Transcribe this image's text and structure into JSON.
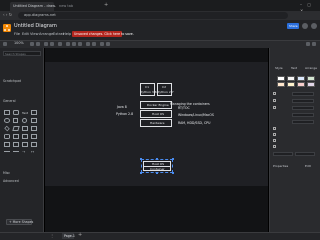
{
  "browser": {
    "tabs": [
      {
        "label": "Untitled Diagram - draw.io"
      },
      {
        "label": "new tab"
      }
    ],
    "url": "app.diagrams.net"
  },
  "app": {
    "title": "Untitled Diagram",
    "menus": [
      "File",
      "Edit",
      "View",
      "Arrange",
      "Extras",
      "Help"
    ],
    "notice": "Unsaved changes. Click here to save.",
    "share_label": "Share",
    "zoom": "100%"
  },
  "left_panel": {
    "search_placeholder": "Search Shapes",
    "sections": [
      "Scratchpad",
      "General",
      "Misc",
      "Advanced"
    ],
    "more_shapes": "+ More Shapes"
  },
  "right_panel": {
    "tabs": [
      "Style",
      "Text",
      "Arrange"
    ],
    "swatch_colors": [
      "#ffffff",
      "#f5f5f5",
      "#dae8fc",
      "#d5e8d4",
      "#ffe6cc",
      "#fff2cc",
      "#f8cecc",
      "#e1d5e7"
    ],
    "properties_label": "Properties",
    "edit_label": "Edit"
  },
  "diagram": {
    "c1": "C1",
    "c1_sub": "Python 3.6",
    "c2": "C2",
    "c2_sub": "Python 2.7",
    "docker_engine": "Docker Engine",
    "java": "Java 8",
    "python": "Python 2.8",
    "host_os": "Host OS",
    "hardware": "Hardware",
    "note1": "Managing the containers",
    "note2": "RT/TOC",
    "note3": "Windows/Linux/MacOS",
    "note4": "RAM, HDD/SSD, CPU",
    "bottom_top": "Host OS",
    "bottom_bottom": "Container"
  },
  "pages": [
    "Page-1"
  ]
}
